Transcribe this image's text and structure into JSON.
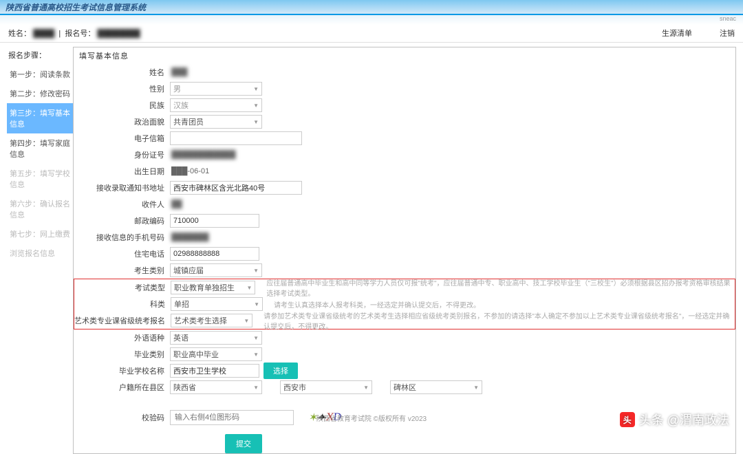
{
  "header": {
    "title": "陕西省普通高校招生考试信息管理系统",
    "brand": "sneac"
  },
  "info_bar": {
    "name_label": "姓名：",
    "name_value": "████",
    "reg_label": "报名号：",
    "reg_value": "████████",
    "records_link": "生源清单",
    "register_link": "注销"
  },
  "sidebar": {
    "title": "报名步骤：",
    "items": [
      {
        "label": "第一步：阅读条款",
        "state": ""
      },
      {
        "label": "第二步：修改密码",
        "state": ""
      },
      {
        "label": "第三步：填写基本信息",
        "state": "active"
      },
      {
        "label": "第四步：填写家庭信息",
        "state": ""
      },
      {
        "label": "第五步：填写学校信息",
        "state": "disabled"
      },
      {
        "label": "第六步：确认报名信息",
        "state": "disabled"
      },
      {
        "label": "第七步：网上缴费",
        "state": "disabled"
      },
      {
        "label": "浏览报名信息",
        "state": "disabled"
      }
    ]
  },
  "content": {
    "title": "填写基本信息"
  },
  "form": {
    "name": {
      "label": "姓名",
      "value": "███"
    },
    "gender": {
      "label": "性别",
      "value": "男"
    },
    "ethnic": {
      "label": "民族",
      "value": "汉族"
    },
    "political": {
      "label": "政治面貌",
      "value": "共青团员"
    },
    "email": {
      "label": "电子信箱",
      "value": ""
    },
    "idcard": {
      "label": "身份证号",
      "value": "████████████"
    },
    "birthday": {
      "label": "出生日期",
      "value": "███-06-01"
    },
    "address": {
      "label": "接收录取通知书地址",
      "value": "西安市碑林区含光北路40号"
    },
    "recipient": {
      "label": "收件人",
      "value": "██"
    },
    "postcode": {
      "label": "邮政编码",
      "value": "710000"
    },
    "mobile": {
      "label": "接收信息的手机号码",
      "value": "███████"
    },
    "homephone": {
      "label": "住宅电话",
      "value": "02988888888"
    },
    "candidate_type": {
      "label": "考生类别",
      "value": "城镇应届"
    },
    "exam_type": {
      "label": "考试类型",
      "value": "职业教育单独招生",
      "hint": "应往届普通高中毕业生和高中同等学力人员仅可报\"统考\"，应往届普通中专、职业高中、技工学校毕业生（\"三校生\"）必须根据县区招办报考资格审核结果选择考试类型。"
    },
    "subject": {
      "label": "科类",
      "value": "单招",
      "hint": "请考生认真选择本人报考科类，一经选定并确认提交后，不得更改。"
    },
    "art_exam": {
      "label": "艺术类专业课省级统考报名",
      "value": "艺术类考生选择",
      "hint": "请参加艺术类专业课省级统考的艺术类考生选择相应省级统考类别报名，不参加的请选择\"本人确定不参加以上艺术类专业课省级统考报名\"，一经选定并确认提交后，不得更改。"
    },
    "language": {
      "label": "外语语种",
      "value": "英语"
    },
    "grad_type": {
      "label": "毕业类别",
      "value": "职业高中毕业"
    },
    "school_name": {
      "label": "毕业学校名称",
      "value": "西安市卫生学校",
      "btn": "选择"
    },
    "region": {
      "label": "户籍所在县区",
      "province": "陕西省",
      "city": "西安市",
      "district": "碑林区"
    },
    "captcha": {
      "label": "校验码",
      "placeholder": "输入右侧4位图形码",
      "text": "⭐ XD"
    },
    "submit": "提交"
  },
  "footer": {
    "text": "陕西省教育考试院 ©版权所有 v2023"
  },
  "watermark": {
    "text": "头条 @渭南政法"
  }
}
